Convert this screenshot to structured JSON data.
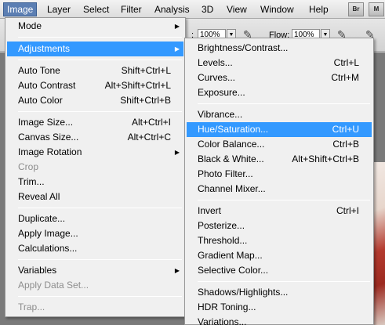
{
  "menubar": {
    "items": [
      "Image",
      "Layer",
      "Select",
      "Filter",
      "Analysis",
      "3D",
      "View",
      "Window",
      "Help"
    ],
    "app_buttons": [
      "Br",
      "M"
    ]
  },
  "options": {
    "field1_label": ":",
    "field1_value": "100%",
    "flow_label": "Flow:",
    "flow_value": "100%"
  },
  "image_menu": {
    "items": [
      {
        "label": "Mode",
        "shortcut": "",
        "submenu": true
      },
      {
        "label": "Adjustments",
        "shortcut": "",
        "submenu": true
      },
      {
        "label": "Auto Tone",
        "shortcut": "Shift+Ctrl+L"
      },
      {
        "label": "Auto Contrast",
        "shortcut": "Alt+Shift+Ctrl+L"
      },
      {
        "label": "Auto Color",
        "shortcut": "Shift+Ctrl+B"
      },
      {
        "label": "Image Size...",
        "shortcut": "Alt+Ctrl+I"
      },
      {
        "label": "Canvas Size...",
        "shortcut": "Alt+Ctrl+C"
      },
      {
        "label": "Image Rotation",
        "shortcut": "",
        "submenu": true
      },
      {
        "label": "Crop",
        "shortcut": ""
      },
      {
        "label": "Trim...",
        "shortcut": ""
      },
      {
        "label": "Reveal All",
        "shortcut": ""
      },
      {
        "label": "Duplicate...",
        "shortcut": ""
      },
      {
        "label": "Apply Image...",
        "shortcut": ""
      },
      {
        "label": "Calculations...",
        "shortcut": ""
      },
      {
        "label": "Variables",
        "shortcut": "",
        "submenu": true
      },
      {
        "label": "Apply Data Set...",
        "shortcut": ""
      },
      {
        "label": "Trap...",
        "shortcut": ""
      }
    ]
  },
  "adjust_menu": {
    "items": [
      {
        "label": "Brightness/Contrast...",
        "shortcut": ""
      },
      {
        "label": "Levels...",
        "shortcut": "Ctrl+L"
      },
      {
        "label": "Curves...",
        "shortcut": "Ctrl+M"
      },
      {
        "label": "Exposure...",
        "shortcut": ""
      },
      {
        "label": "Vibrance...",
        "shortcut": ""
      },
      {
        "label": "Hue/Saturation...",
        "shortcut": "Ctrl+U"
      },
      {
        "label": "Color Balance...",
        "shortcut": "Ctrl+B"
      },
      {
        "label": "Black & White...",
        "shortcut": "Alt+Shift+Ctrl+B"
      },
      {
        "label": "Photo Filter...",
        "shortcut": ""
      },
      {
        "label": "Channel Mixer...",
        "shortcut": ""
      },
      {
        "label": "Invert",
        "shortcut": "Ctrl+I"
      },
      {
        "label": "Posterize...",
        "shortcut": ""
      },
      {
        "label": "Threshold...",
        "shortcut": ""
      },
      {
        "label": "Gradient Map...",
        "shortcut": ""
      },
      {
        "label": "Selective Color...",
        "shortcut": ""
      },
      {
        "label": "Shadows/Highlights...",
        "shortcut": ""
      },
      {
        "label": "HDR Toning...",
        "shortcut": ""
      },
      {
        "label": "Variations...",
        "shortcut": ""
      }
    ]
  }
}
